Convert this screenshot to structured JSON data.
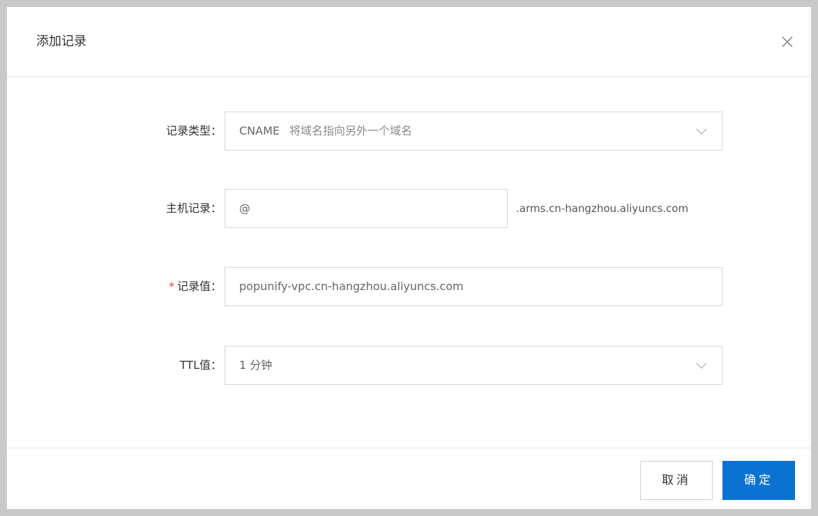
{
  "dialog": {
    "title": "添加记录",
    "close_icon": "close-icon"
  },
  "form": {
    "record_type": {
      "label": "记录类型：",
      "value": "CNAME",
      "description": "将域名指向另外一个域名",
      "icon": "chevron-down-icon"
    },
    "host_record": {
      "label": "主机记录：",
      "value": "@",
      "suffix": ".arms.cn-hangzhou.aliyuncs.com"
    },
    "record_value": {
      "required_mark": "*",
      "label": "记录值：",
      "value": "popunify-vpc.cn-hangzhou.aliyuncs.com"
    },
    "ttl": {
      "label": "TTL值：",
      "value": "1 分钟",
      "icon": "chevron-down-icon"
    }
  },
  "footer": {
    "cancel_label": "取消",
    "ok_label": "确定"
  },
  "colors": {
    "primary": "#0a73d1",
    "required": "#e53b3b",
    "border": "#d7d7d7"
  }
}
